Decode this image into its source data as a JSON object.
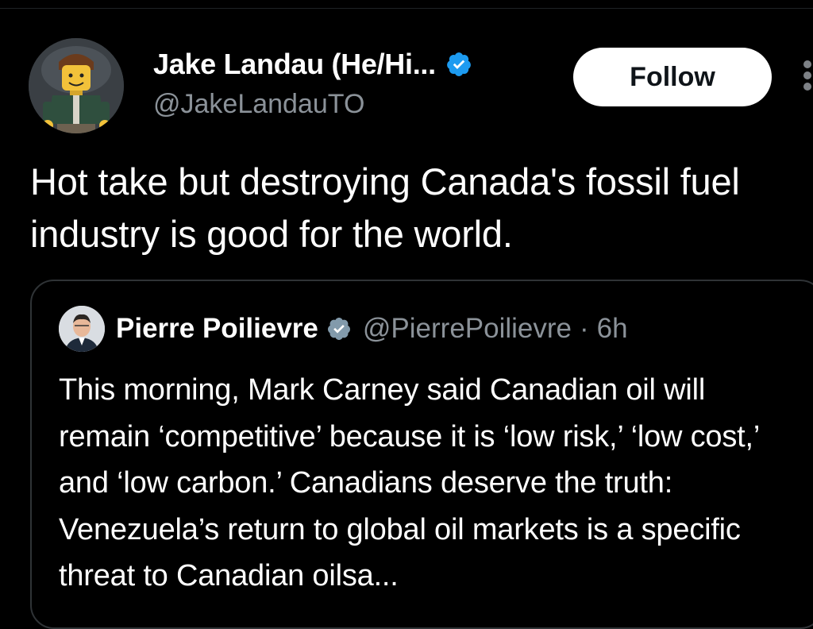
{
  "author": {
    "display_name": "Jake Landau (He/Hi...",
    "handle": "@JakeLandauTO",
    "avatar_icon": "lego-minifigure-avatar",
    "verified_icon": "verified-badge-icon"
  },
  "actions": {
    "follow_label": "Follow",
    "more_icon": "more-options-icon"
  },
  "tweet": {
    "text": "Hot take but destroying Canada's fossil fuel industry is good for the world."
  },
  "quoted_tweet": {
    "display_name": "Pierre Poilievre",
    "handle": "@PierrePoilievre",
    "separator": "·",
    "time": "6h",
    "text": "This morning, Mark Carney said Canadian oil will remain ‘competitive’ because it is ‘low risk,’ ‘low cost,’ and ‘low carbon.’ Canadians deserve the truth: Venezuela’s return to global oil markets is a specific threat to Canadian oilsa...",
    "verified_icon": "verified-badge-gray-icon"
  },
  "colors": {
    "background": "#000000",
    "text_primary": "#ffffff",
    "text_secondary": "#8b9299",
    "verified_blue": "#1d9bf0",
    "verified_gray": "#829aab",
    "border": "#2f3336"
  }
}
